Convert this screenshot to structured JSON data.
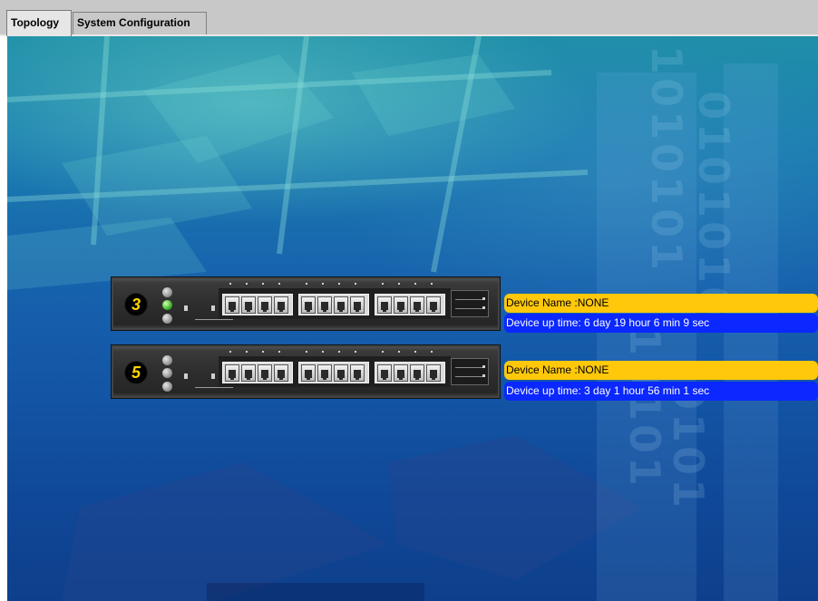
{
  "tabs": [
    {
      "label": "Topology",
      "active": true
    },
    {
      "label": "System Configuration",
      "active": false
    }
  ],
  "devices": [
    {
      "unit": "3",
      "leds": [
        "off",
        "on",
        "off"
      ],
      "device_name": "Device Name :NONE",
      "uptime": "Device up time: 6 day 19 hour 6 min 9 sec"
    },
    {
      "unit": "5",
      "leds": [
        "off",
        "off",
        "off"
      ],
      "device_name": "Device Name :NONE",
      "uptime": "Device up time: 3 day 1 hour 56 min 1 sec"
    }
  ],
  "colors": {
    "name_label_bg": "#ffc80a",
    "uptime_label_bg": "#0a28ff",
    "unit_number": "#ffd400",
    "led_on": "#3db52a"
  },
  "icons": {
    "led": "circle",
    "port": "rj45-port-icon"
  }
}
